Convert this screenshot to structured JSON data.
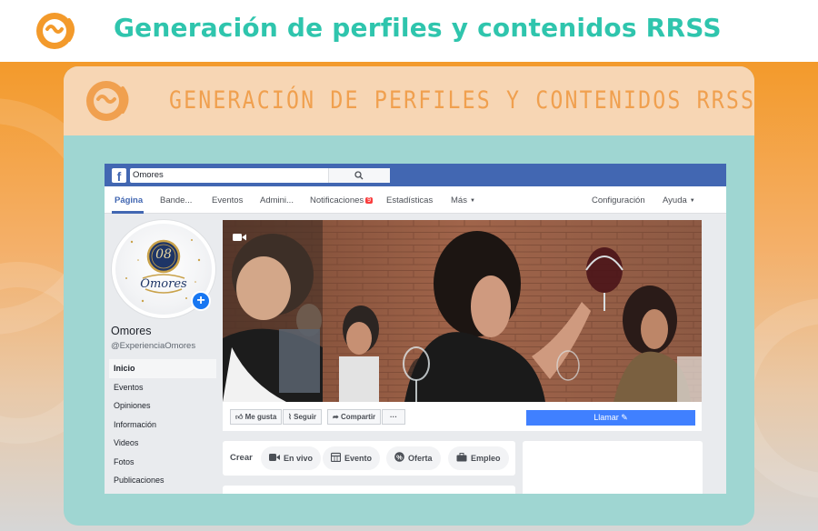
{
  "header": {
    "title": "Generación de perfiles y contenidos RRSS"
  },
  "card": {
    "title": "GENERACIÓN DE PERFILES Y CONTENIDOS RRSS"
  },
  "facebook": {
    "search_value": "Omores",
    "tabs": [
      "Página",
      "Bande...",
      "Eventos",
      "Admini...",
      "Notificaciones",
      "Estadísticas",
      "Más",
      "Configuración",
      "Ayuda"
    ],
    "notification_count": "9",
    "page_name": "Omores",
    "page_handle": "@ExperienciaOmores",
    "sidebar": [
      "Inicio",
      "Eventos",
      "Opiniones",
      "Información",
      "Videos",
      "Fotos",
      "Publicaciones"
    ],
    "actions": {
      "like": "Me gusta",
      "follow": "Seguir",
      "share": "Compartir",
      "more": "···",
      "call": "Llamar"
    },
    "create": {
      "label": "Crear",
      "options": [
        "En vivo",
        "Evento",
        "Oferta",
        "Empleo"
      ]
    },
    "profile_logo": {
      "number": "08",
      "text": "Omores"
    }
  },
  "colors": {
    "header_title": "#2fc5ad",
    "orange": "#f39a2b",
    "card_teal": "#9fd6d2",
    "card_peach": "#f7d6b4",
    "fb_blue": "#4267b2",
    "call_button": "#4080ff"
  }
}
